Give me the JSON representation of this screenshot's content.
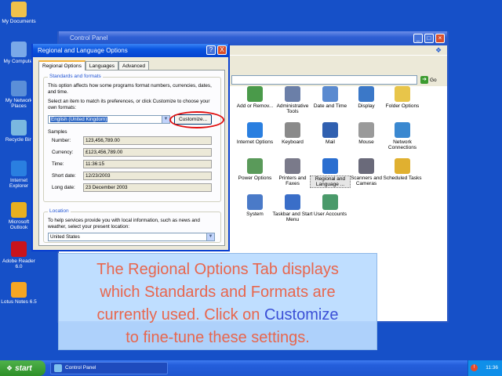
{
  "desktop": {
    "icons": [
      {
        "label": "My Documents",
        "icon": "my-documents-icon",
        "color": "#f0c14b"
      },
      {
        "label": "My Computer",
        "icon": "my-computer-icon",
        "color": "#7aa9e8"
      },
      {
        "label": "My Network Places",
        "icon": "my-network-places-icon",
        "color": "#5b8fd8"
      },
      {
        "label": "Recycle Bin",
        "icon": "recycle-bin-icon",
        "color": "#7ab8e0"
      },
      {
        "label": "Internet Explorer",
        "icon": "internet-explorer-icon",
        "color": "#2a7fe0"
      },
      {
        "label": "Microsoft Outlook",
        "icon": "outlook-icon",
        "color": "#e8b020"
      },
      {
        "label": "Adobe Reader 6.0",
        "icon": "adobe-reader-icon",
        "color": "#c8141c"
      },
      {
        "label": "Lotus Notes 6.5",
        "icon": "lotus-notes-icon",
        "color": "#f5a623"
      }
    ]
  },
  "control_panel": {
    "title": "Control Panel",
    "go_label": "Go",
    "items": [
      {
        "label": "Add or Remov...",
        "icon": "add-remove-programs-icon",
        "color": "#4a9a4a"
      },
      {
        "label": "Administrative Tools",
        "icon": "administrative-tools-icon",
        "color": "#6b7fa8"
      },
      {
        "label": "Date and Time",
        "icon": "date-time-icon",
        "color": "#5a8ad0"
      },
      {
        "label": "Display",
        "icon": "display-icon",
        "color": "#3b78c8"
      },
      {
        "label": "Folder Options",
        "icon": "folder-options-icon",
        "color": "#e8c54a"
      },
      {
        "label": "Internet Options",
        "icon": "internet-options-icon",
        "color": "#2a7fe0"
      },
      {
        "label": "Keyboard",
        "icon": "keyboard-icon",
        "color": "#8a8a8a"
      },
      {
        "label": "Mail",
        "icon": "mail-icon",
        "color": "#3060b0"
      },
      {
        "label": "Mouse",
        "icon": "mouse-icon",
        "color": "#9a9a9a"
      },
      {
        "label": "Network Connections",
        "icon": "network-connections-icon",
        "color": "#3a88d0"
      },
      {
        "label": "Power Options",
        "icon": "power-options-icon",
        "color": "#5a9a5a"
      },
      {
        "label": "Printers and Faxes",
        "icon": "printers-faxes-icon",
        "color": "#7a7a8a"
      },
      {
        "label": "Regional and Language ...",
        "icon": "regional-language-icon",
        "color": "#2a6ed0"
      },
      {
        "label": "Scanners and Cameras",
        "icon": "scanners-cameras-icon",
        "color": "#6a6a7a"
      },
      {
        "label": "Scheduled Tasks",
        "icon": "scheduled-tasks-icon",
        "color": "#e0b030"
      },
      {
        "label": "System",
        "icon": "system-icon",
        "color": "#4a7ac8"
      },
      {
        "label": "Taskbar and Start Menu",
        "icon": "taskbar-start-menu-icon",
        "color": "#3a6ec8"
      },
      {
        "label": "User Accounts",
        "icon": "user-accounts-icon",
        "color": "#4a9a6a"
      }
    ]
  },
  "dialog": {
    "title": "Regional and Language Options",
    "help_label": "?",
    "close_label": "X",
    "tabs": [
      "Regional Options",
      "Languages",
      "Advanced"
    ],
    "standards": {
      "group_label": "Standards and formats",
      "description": "This option affects how some programs format numbers, currencies, dates, and time.",
      "select_prompt": "Select an item to match its preferences, or click Customize to choose your own formats:",
      "selected_format": "English (United Kingdom)",
      "customize_label": "Customize..."
    },
    "samples": {
      "label": "Samples",
      "rows": [
        {
          "label": "Number:",
          "value": "123,456,789.00"
        },
        {
          "label": "Currency:",
          "value": "£123,456,789.00"
        },
        {
          "label": "Time:",
          "value": "11:36:15"
        },
        {
          "label": "Short date:",
          "value": "12/23/2003"
        },
        {
          "label": "Long date:",
          "value": "23 December 2003"
        }
      ]
    },
    "location": {
      "group_label": "Location",
      "description": "To help services provide you with local information, such as news and weather, select your present location:",
      "selected": "United States"
    }
  },
  "overlay": {
    "line1": "The Regional Options Tab displays",
    "line2": "which Standards and Formats are",
    "line3_before": "currently used. Click on ",
    "line3_accent": "Customize",
    "line4": "to fine-tune these settings."
  },
  "taskbar": {
    "start_label": "start",
    "window_label": "Control Panel",
    "clock": "11:36"
  }
}
